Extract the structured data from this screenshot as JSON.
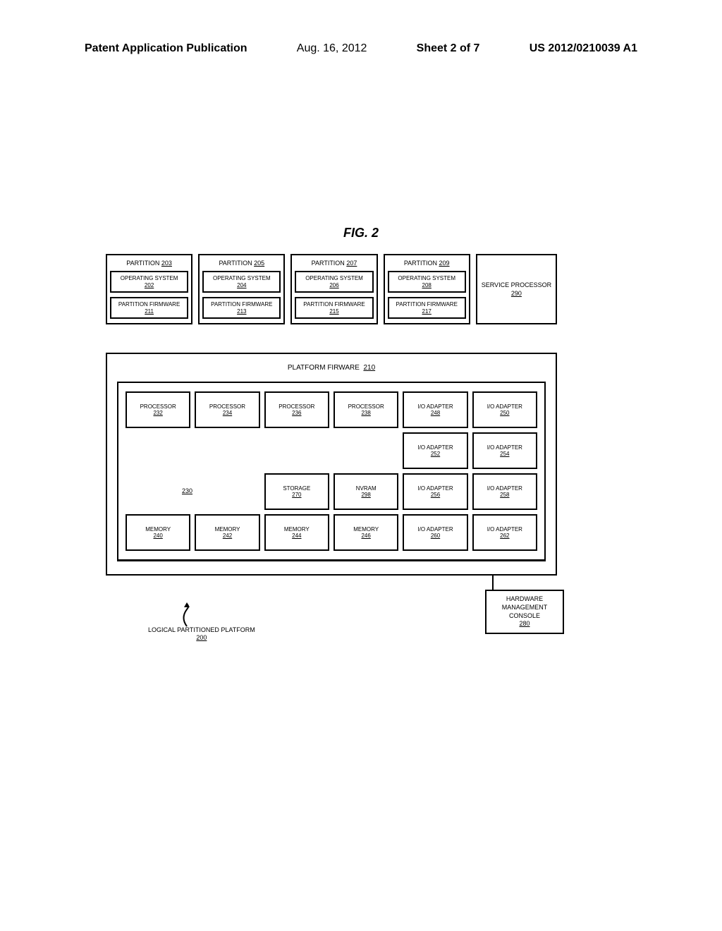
{
  "header": {
    "left": "Patent Application Publication",
    "date": "Aug. 16, 2012",
    "sheet": "Sheet 2 of 7",
    "docnum": "US 2012/0210039 A1"
  },
  "fig_title": "FIG. 2",
  "partitions": [
    {
      "title": "PARTITION",
      "title_num": "203",
      "os_label": "OPERATING SYSTEM",
      "os_num": "202",
      "fw_label": "PARTITION FIRMWARE",
      "fw_num": "211"
    },
    {
      "title": "PARTITION",
      "title_num": "205",
      "os_label": "OPERATING SYSTEM",
      "os_num": "204",
      "fw_label": "PARTITION FIRMWARE",
      "fw_num": "213"
    },
    {
      "title": "PARTITION",
      "title_num": "207",
      "os_label": "OPERATING SYSTEM",
      "os_num": "206",
      "fw_label": "PARTITION FIRMWARE",
      "fw_num": "215"
    },
    {
      "title": "PARTITION",
      "title_num": "209",
      "os_label": "OPERATING SYSTEM",
      "os_num": "208",
      "fw_label": "PARTITION FIRMWARE",
      "fw_num": "217"
    }
  ],
  "service": {
    "label": "SERVICE PROCESSOR",
    "num": "290"
  },
  "platform": {
    "title": "PLATFORM FIRWARE",
    "num": "210"
  },
  "ref_230": "230",
  "hw": {
    "r1c1": {
      "label": "PROCESSOR",
      "num": "232"
    },
    "r1c2": {
      "label": "PROCESSOR",
      "num": "234"
    },
    "r1c3": {
      "label": "PROCESSOR",
      "num": "236"
    },
    "r1c4": {
      "label": "PROCESSOR",
      "num": "238"
    },
    "r1c5": {
      "label": "I/O ADAPTER",
      "num": "248"
    },
    "r1c6": {
      "label": "I/O ADAPTER",
      "num": "250"
    },
    "r2c5": {
      "label": "I/O ADAPTER",
      "num": "252"
    },
    "r2c6": {
      "label": "I/O ADAPTER",
      "num": "254"
    },
    "r3c3": {
      "label": "STORAGE",
      "num": "270"
    },
    "r3c4": {
      "label": "NVRAM",
      "num": "298"
    },
    "r3c5": {
      "label": "I/O ADAPTER",
      "num": "256"
    },
    "r3c6": {
      "label": "I/O ADAPTER",
      "num": "258"
    },
    "r4c1": {
      "label": "MEMORY",
      "num": "240"
    },
    "r4c2": {
      "label": "MEMORY",
      "num": "242"
    },
    "r4c3": {
      "label": "MEMORY",
      "num": "244"
    },
    "r4c4": {
      "label": "MEMORY",
      "num": "246"
    },
    "r4c5": {
      "label": "I/O ADAPTER",
      "num": "260"
    },
    "r4c6": {
      "label": "I/O ADAPTER",
      "num": "262"
    }
  },
  "hmc": {
    "label": "HARDWARE MANAGEMENT CONSOLE",
    "num": "280"
  },
  "lpp": {
    "label": "LOGICAL PARTITIONED PLATFORM",
    "num": "200"
  }
}
